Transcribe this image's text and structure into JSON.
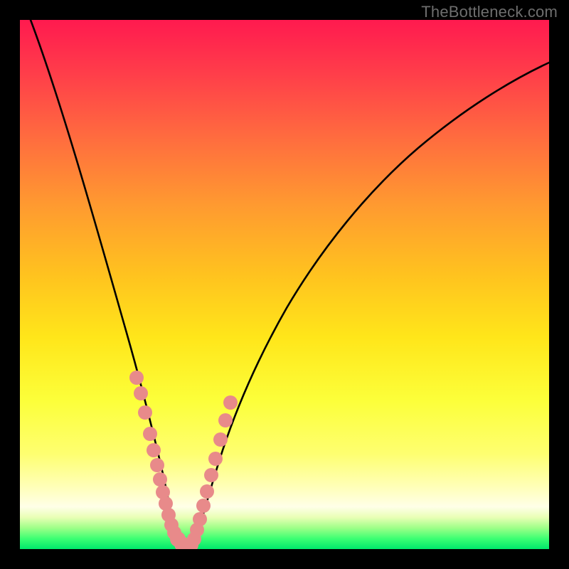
{
  "watermark": "TheBottleneck.com",
  "chart_data": {
    "type": "line",
    "title": "",
    "xlabel": "",
    "ylabel": "",
    "xlim": [
      0,
      100
    ],
    "ylim": [
      0,
      100
    ],
    "series": [
      {
        "name": "left-curve",
        "x": [
          2,
          5,
          10,
          14,
          18,
          20,
          22,
          24,
          25.5,
          26.5,
          27.3,
          28,
          28.7
        ],
        "values": [
          100,
          90,
          73,
          58,
          42,
          34,
          26,
          17.5,
          11,
          6.5,
          3.5,
          1.5,
          0.5
        ]
      },
      {
        "name": "right-curve",
        "x": [
          31.5,
          32,
          33,
          34,
          36,
          38,
          42,
          48,
          56,
          66,
          78,
          90,
          100
        ],
        "values": [
          0.5,
          2,
          6,
          10,
          17,
          24,
          36,
          49,
          61,
          72,
          81,
          87.5,
          92
        ]
      },
      {
        "name": "valley-floor",
        "x": [
          28.7,
          30,
          31.5
        ],
        "values": [
          0.5,
          0.3,
          0.5
        ]
      }
    ],
    "markers": [
      {
        "name": "left-dots",
        "x": [
          21,
          22,
          22.8,
          24,
          24.8,
          25.6,
          26.2,
          26.8,
          27.3,
          27.8,
          28.4,
          28.9,
          29.5,
          30.1,
          30.7
        ],
        "y": [
          30,
          26,
          22.5,
          17,
          14,
          11,
          8.5,
          6.5,
          4.8,
          3.2,
          2,
          1.2,
          0.8,
          0.6,
          0.6
        ]
      },
      {
        "name": "right-dots",
        "x": [
          31.2,
          31.8,
          32.4,
          33.2,
          34,
          34.8,
          35.6,
          36.6,
          37.6,
          38.4
        ],
        "y": [
          0.8,
          2.5,
          5,
          8,
          11,
          14,
          17,
          21,
          25,
          28
        ]
      }
    ],
    "marker_color": "#e88a8a",
    "marker_radius_px": 10
  }
}
